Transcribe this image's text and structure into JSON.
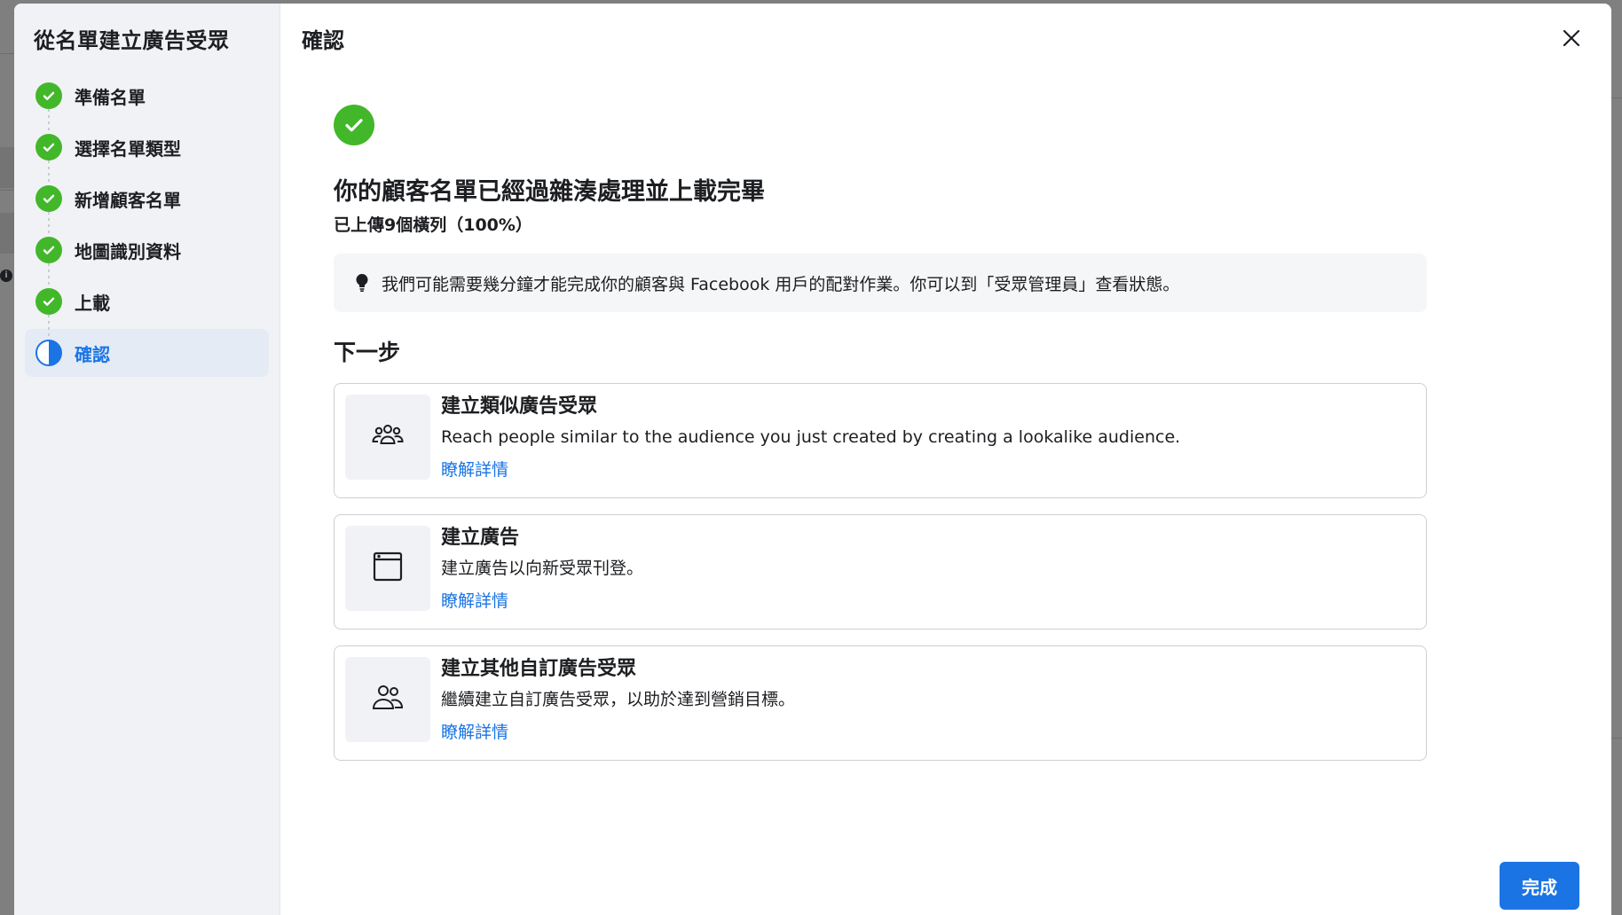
{
  "sidebar": {
    "title": "從名單建立廣告受眾",
    "steps": [
      {
        "label": "準備名單",
        "status": "done"
      },
      {
        "label": "選擇名單類型",
        "status": "done"
      },
      {
        "label": "新增顧客名單",
        "status": "done"
      },
      {
        "label": "地圖識別資料",
        "status": "done"
      },
      {
        "label": "上載",
        "status": "done"
      },
      {
        "label": "確認",
        "status": "active"
      }
    ]
  },
  "header": {
    "title": "確認"
  },
  "main": {
    "headline": "你的顧客名單已經過雜湊處理並上載完畢",
    "subline": "已上傳9個橫列（100%）",
    "tip": "我們可能需要幾分鐘才能完成你的顧客與 Facebook 用戶的配對作業。你可以到「受眾管理員」查看狀態。",
    "next_title": "下一步",
    "cards": [
      {
        "icon": "group-icon",
        "title": "建立類似廣告受眾",
        "desc": "Reach people similar to the audience you just created by creating a lookalike audience.",
        "link": "瞭解詳情"
      },
      {
        "icon": "ad-window-icon",
        "title": "建立廣告",
        "desc": "建立廣告以向新受眾刊登。",
        "link": "瞭解詳情"
      },
      {
        "icon": "people-icon",
        "title": "建立其他自訂廣告受眾",
        "desc": "繼續建立自訂廣告受眾，以助於達到營銷目標。",
        "link": "瞭解詳情"
      }
    ]
  },
  "footer": {
    "done_label": "完成"
  },
  "colors": {
    "accent": "#1b74e4",
    "success": "#42b72a",
    "sidebar_bg": "#f0f2f5"
  }
}
